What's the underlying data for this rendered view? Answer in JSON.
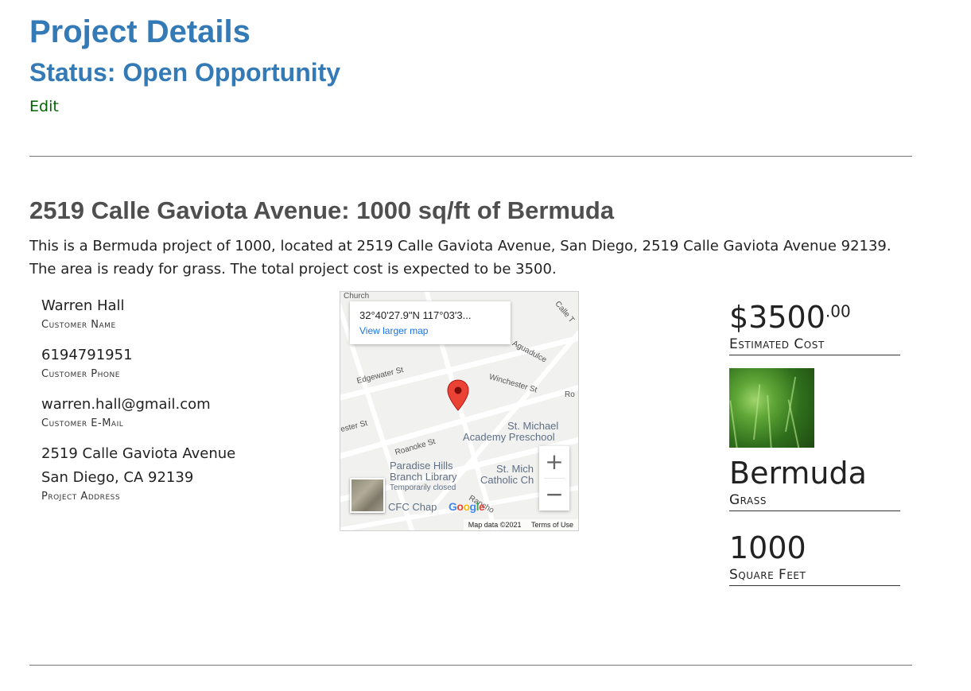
{
  "header": {
    "title": "Project Details",
    "status": "Status: Open Opportunity",
    "edit_label": "Edit"
  },
  "project": {
    "heading": "2519 Calle Gaviota Avenue: 1000 sq/ft of Bermuda",
    "description": "This is a Bermuda project of 1000, located at 2519 Calle Gaviota Avenue, San Diego, 2519 Calle Gaviota Avenue 92139. The area is ready for grass. The total project cost is expected to be 3500."
  },
  "customer": {
    "name": "Warren Hall",
    "name_label": "Customer Name",
    "phone": "6194791951",
    "phone_label": "Customer Phone",
    "email": "warren.hall@gmail.com",
    "email_label": "Customer E-Mail",
    "address_line1": "2519 Calle Gaviota Avenue",
    "address_line2": "San Diego, CA 92139",
    "address_label": "Project Address"
  },
  "map": {
    "coords": "32°40'27.9\"N 117°03'3...",
    "larger_map_link": "View larger map",
    "streets": [
      "Edgewater St",
      "Winchester St",
      "Aguadulce",
      "Roanoke St",
      "Calle T",
      "Rancho",
      "Church",
      "ester St",
      "Ro"
    ],
    "pois": [
      "St. Michael",
      "Academy Preschool",
      "Paradise Hills",
      "Branch Library",
      "Temporarily closed",
      "St. Mich",
      "Catholic Ch",
      "CFC Chap"
    ],
    "zoom_in": "+",
    "zoom_out": "−",
    "attribution": "Map data ©2021",
    "terms": "Terms of Use",
    "google_logo": "Google"
  },
  "stats": {
    "cost_main": "$3500",
    "cost_cents": ".00",
    "cost_label": "Estimated Cost",
    "grass_name": "Bermuda",
    "grass_label": "Grass",
    "sqft": "1000",
    "sqft_label": "Square Feet"
  },
  "colors": {
    "heading_blue": "#337ab7",
    "edit_green": "#006400",
    "pin_red": "#ea4335"
  }
}
